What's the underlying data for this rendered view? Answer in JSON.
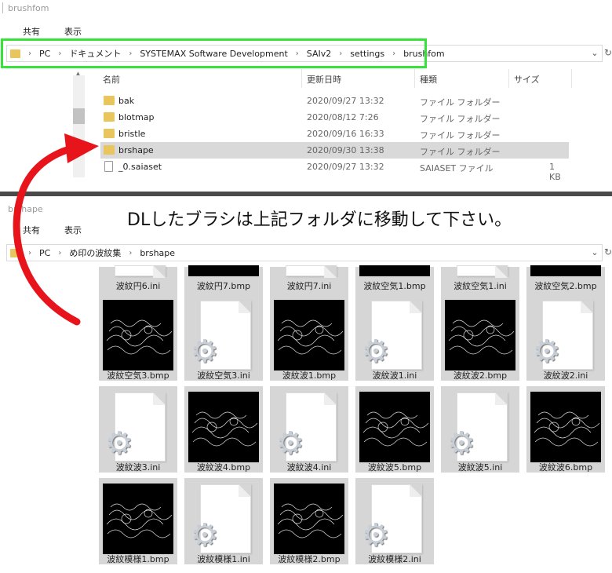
{
  "window1": {
    "title": "brushfom",
    "ribbon": {
      "share": "共有",
      "view": "表示"
    },
    "address": [
      "PC",
      "ドキュメント",
      "SYSTEMAX Software Development",
      "SAIv2",
      "settings",
      "brushfom"
    ],
    "columns": {
      "name": "名前",
      "date": "更新日時",
      "type": "種類",
      "size": "サイズ"
    },
    "rows": [
      {
        "name": "bak",
        "date": "2020/09/27 13:32",
        "type": "ファイル フォルダー",
        "size": "",
        "icon": "folder-icon"
      },
      {
        "name": "blotmap",
        "date": "2020/08/12 7:26",
        "type": "ファイル フォルダー",
        "size": "",
        "icon": "folder-icon"
      },
      {
        "name": "bristle",
        "date": "2020/09/16 16:33",
        "type": "ファイル フォルダー",
        "size": "",
        "icon": "folder-icon"
      },
      {
        "name": "brshape",
        "date": "2020/09/30 13:38",
        "type": "ファイル フォルダー",
        "size": "",
        "icon": "folder-icon"
      },
      {
        "name": "_0.saiaset",
        "date": "2020/09/27 13:32",
        "type": "SAIASET ファイル",
        "size": "1 KB",
        "icon": "file-icon"
      }
    ]
  },
  "window2": {
    "title": "brshape",
    "ribbon": {
      "share": "共有",
      "view": "表示"
    },
    "address": [
      "PC",
      "め印の波紋集",
      "brshape"
    ],
    "tiles": [
      {
        "name": "波紋円6.ini",
        "kind": "ini"
      },
      {
        "name": "波紋円7.bmp",
        "kind": "bmp"
      },
      {
        "name": "波紋円7.ini",
        "kind": "ini"
      },
      {
        "name": "波紋空気1.bmp",
        "kind": "bmp"
      },
      {
        "name": "波紋空気1.ini",
        "kind": "ini"
      },
      {
        "name": "波紋空気2.bmp",
        "kind": "bmp"
      },
      {
        "name": "波紋空気3.bmp",
        "kind": "bmp"
      },
      {
        "name": "波紋空気3.ini",
        "kind": "ini"
      },
      {
        "name": "波紋波1.bmp",
        "kind": "bmp"
      },
      {
        "name": "波紋波1.ini",
        "kind": "ini"
      },
      {
        "name": "波紋波2.bmp",
        "kind": "bmp"
      },
      {
        "name": "波紋波2.ini",
        "kind": "ini"
      },
      {
        "name": "波紋波3.ini",
        "kind": "ini"
      },
      {
        "name": "波紋波4.bmp",
        "kind": "bmp"
      },
      {
        "name": "波紋波4.ini",
        "kind": "ini"
      },
      {
        "name": "波紋波5.bmp",
        "kind": "bmp"
      },
      {
        "name": "波紋波5.ini",
        "kind": "ini"
      },
      {
        "name": "波紋波6.bmp",
        "kind": "bmp"
      },
      {
        "name": "波紋模様1.bmp",
        "kind": "bmp"
      },
      {
        "name": "波紋模様1.ini",
        "kind": "ini"
      },
      {
        "name": "波紋模様2.bmp",
        "kind": "bmp"
      },
      {
        "name": "波紋模様2.ini",
        "kind": "ini"
      }
    ]
  },
  "annotation": {
    "message": "DLしたブラシは上記フォルダに移動して下さい。"
  },
  "colors": {
    "highlight": "#37e23a",
    "arrow": "#e8141b",
    "folder": "#e9c55d"
  }
}
